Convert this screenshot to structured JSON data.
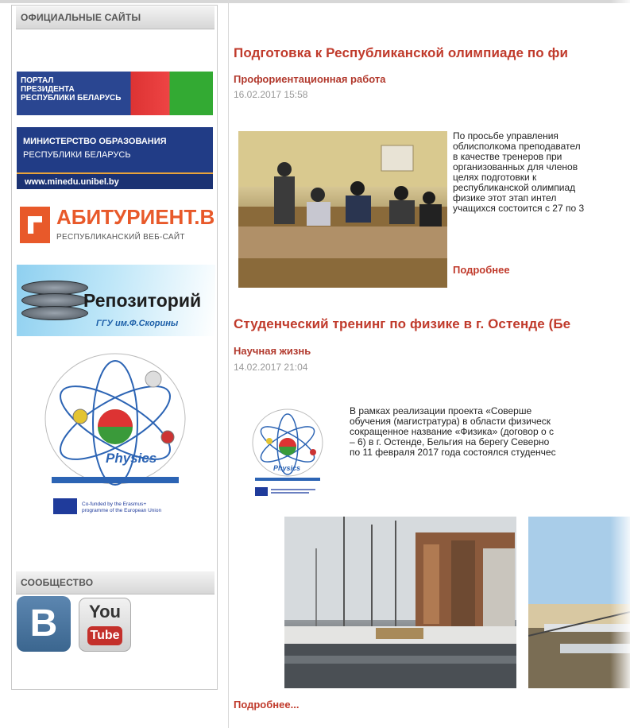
{
  "sidebar": {
    "official_heading": "ОФИЦИАЛЬНЫЕ САЙТЫ",
    "portal": {
      "line1": "ПОРТАЛ",
      "line2": "ПРЕЗИДЕНТА",
      "line3": "РЕСПУБЛИКИ БЕЛАРУСЬ"
    },
    "minedu": {
      "line1": "МИНИСТЕРСТВО ОБРАЗОВАНИЯ",
      "line2": "РЕСПУБЛИКИ БЕЛАРУСЬ",
      "url": "www.minedu.unibel.by"
    },
    "abiturient": {
      "name": "АБИТУРИЕНТ.BY",
      "subtitle": "РЕСПУБЛИКАНСКИЙ ВЕБ-САЙТ"
    },
    "repository": {
      "name": "Репозиторий",
      "subtitle": "ГГУ им.Ф.Скорины"
    },
    "physics": {
      "name": "Physics",
      "caption1": "Co-funded by the Erasmus+",
      "caption2": "programme of the European Union"
    },
    "community_heading": "СООБЩЕСТВО",
    "vk_letter": "B",
    "youtube": {
      "top": "You",
      "bottom": "Tube"
    }
  },
  "articles": [
    {
      "title": "Подготовка к Республиканской олимпиаде по фи",
      "category": "Профориентационная работа",
      "date": "16.02.2017 15:58",
      "lines": [
        "По      просьбе      управления",
        "облисполкома преподавател",
        "в   качестве   тренеров   при",
        "организованных для членов",
        "целях        подготовки        к",
        "республиканской олимпиад",
        "физике    этот    этап    интел",
        "учащихся состоится с 27 по 3"
      ],
      "more": "Подробнее"
    },
    {
      "title": "Студенческий тренинг по физике в г. Остенде (Бе",
      "category": "Научная жизнь",
      "date": "14.02.2017 21:04",
      "lines": [
        "В   рамках   реализации   проекта   «Соверше",
        "обучения (магистратура) в области физическ",
        "сокращенное название «Физика» (договор о с",
        "– 6) в г. Остенде, Бельгия на берегу Северно",
        "по 11 февраля 2017 года состоялся студенчес"
      ],
      "more": "Подробнее..."
    }
  ],
  "colors": {
    "title": "#c03a2b",
    "date": "#999999",
    "heading_bg": "#d7d7d7"
  }
}
